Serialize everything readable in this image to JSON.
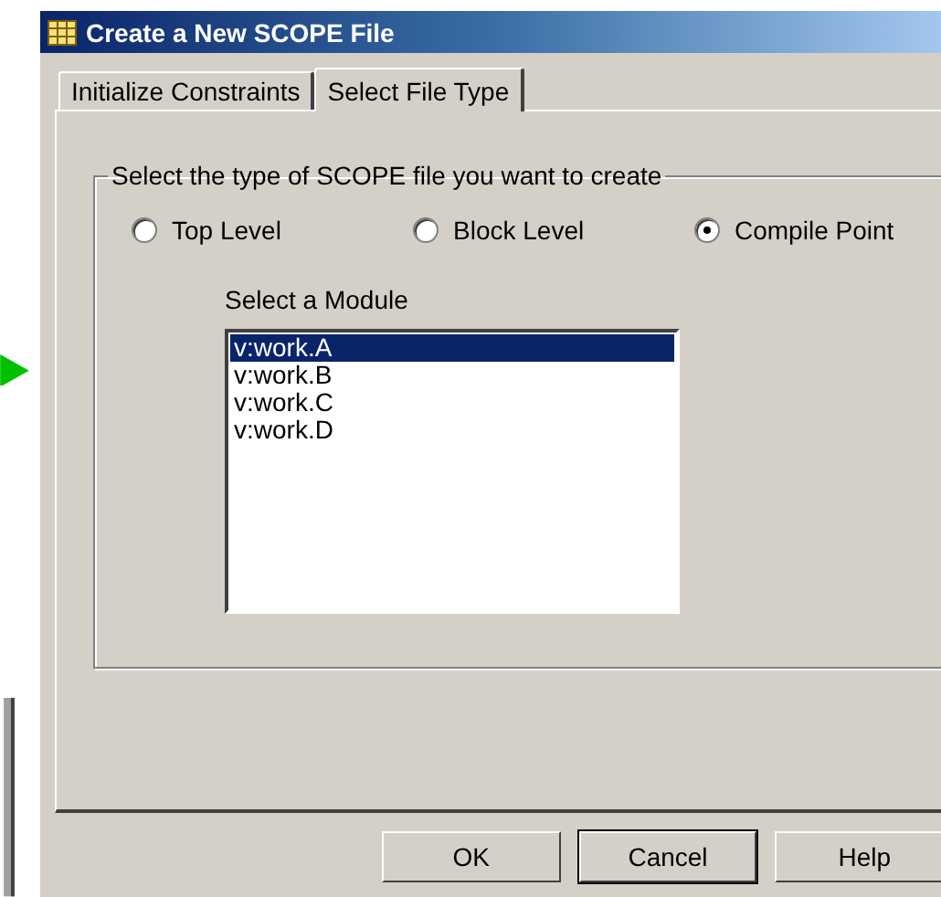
{
  "window": {
    "title": "Create a New SCOPE File"
  },
  "tabs": [
    {
      "label": "Initialize Constraints",
      "selected": false
    },
    {
      "label": "Select File Type",
      "selected": true
    }
  ],
  "file_type": {
    "legend": "Select the type of SCOPE file you want to create",
    "options": [
      {
        "label": "Top Level",
        "selected": false
      },
      {
        "label": "Block Level",
        "selected": false
      },
      {
        "label": "Compile Point",
        "selected": true
      }
    ]
  },
  "module": {
    "label": "Select a Module",
    "items": [
      {
        "label": "v:work.A",
        "selected": true
      },
      {
        "label": "v:work.B",
        "selected": false
      },
      {
        "label": "v:work.C",
        "selected": false
      },
      {
        "label": "v:work.D",
        "selected": false
      }
    ]
  },
  "buttons": [
    {
      "label": "OK",
      "default": false
    },
    {
      "label": "Cancel",
      "default": true
    },
    {
      "label": "Help",
      "default": false
    }
  ]
}
